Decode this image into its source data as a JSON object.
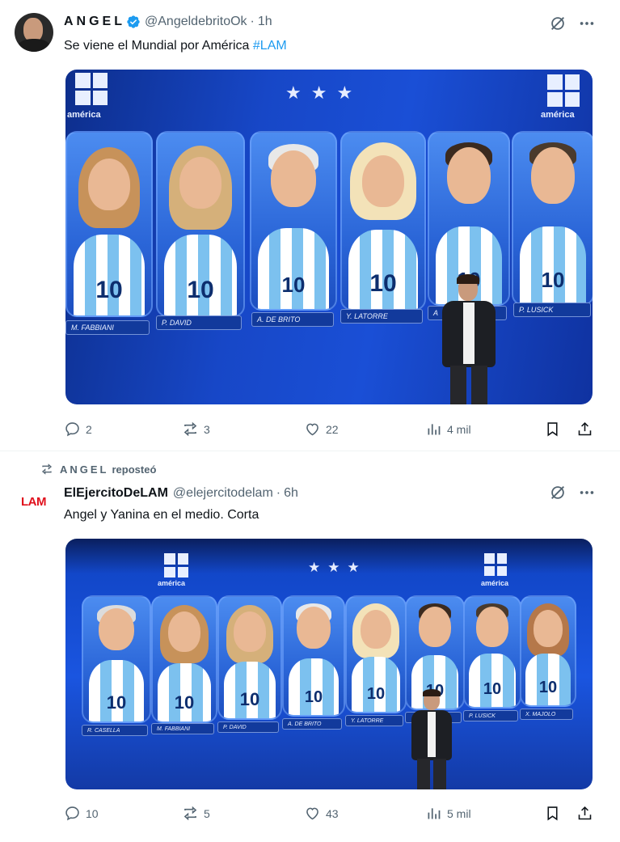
{
  "tweet1": {
    "name": "ANGEL",
    "handle": "@AngeldebritoOk",
    "time": "1h",
    "text_main": "Se viene el Mundial por América ",
    "hashtag": "#LAM",
    "media": {
      "channel": "américa",
      "labels": [
        "M. FABBIANI",
        "P. DAVID",
        "A. DE BRITO",
        "Y. LATORRE",
        "A",
        "P. LUSICK"
      ]
    },
    "actions": {
      "replies": "2",
      "reposts": "3",
      "likes": "22",
      "views": "4 mil"
    }
  },
  "repost_line": {
    "user": "ANGEL",
    "label": "reposteó"
  },
  "tweet2": {
    "avatar_text": "LAM",
    "name": "ElEjercitoDeLAM",
    "handle": "@elejercitodelam",
    "time": "6h",
    "text": "Angel y Yanina en el medio. Corta",
    "media": {
      "channel": "américa",
      "labels": [
        "R. CASELLA",
        "M. FABBIANI",
        "P. DAVID",
        "A. DE BRITO",
        "Y. LATORRE",
        "",
        "P. LUSICK",
        "X. MAJOLO"
      ]
    },
    "actions": {
      "replies": "10",
      "reposts": "5",
      "likes": "43",
      "views": "5 mil"
    }
  },
  "colors": {
    "accent": "#1d9bf0",
    "muted": "#536471",
    "lam_red": "#e0101c",
    "stage_blue": "#1a4fd6"
  }
}
